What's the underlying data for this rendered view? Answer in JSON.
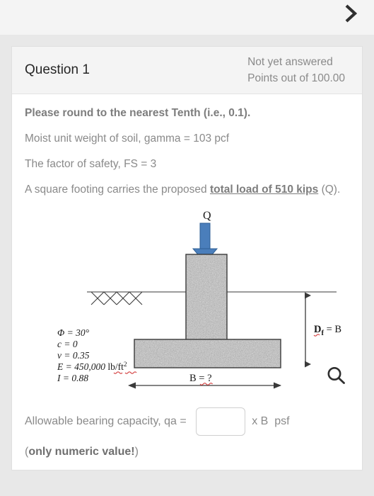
{
  "topbar": {
    "next_icon": "chevron-right-icon",
    "next_label": ""
  },
  "question": {
    "number_label": "Question 1",
    "status_line_1": "Not yet answered",
    "status_line_2": "Points out of 100.00",
    "body": {
      "line_1": "Please round to the nearest Tenth (i.e., 0.1).",
      "line_2": "Moist unit weight of soil, gamma = 103 pcf",
      "line_3": "The factor of safety, FS = 3",
      "line_4_prefix": "A square footing carries the proposed ",
      "line_4_emphasis": "total load of 510 kips",
      "line_4_suffix": " (Q)."
    }
  },
  "figure": {
    "load_label": "Q",
    "depth_label_main": "D",
    "depth_label_sub": "f",
    "depth_label_rest": " = B",
    "width_label": "B = ?",
    "soil_params": [
      "Φ = 30°",
      "c = 0",
      "ν = 0.35",
      "E = 450,000 lb/ft²",
      "I = 0.88"
    ],
    "param_E_value": "E = 450,000 ",
    "param_E_units": "lb/ft",
    "param_E_units_sup": "2",
    "magnifier_icon": "search-icon",
    "colors": {
      "arrow_blue": "#4a7ebb",
      "arrow_blue_dark": "#2e5f94",
      "concrete_gray": "#b8b8b8",
      "line_black": "#3a3a3a",
      "spellcheck_red": "#d23b3b"
    }
  },
  "answer": {
    "label": "Allowable bearing capacity, qa = ",
    "input_value": "",
    "input_placeholder": "",
    "unit": "x B  psf",
    "note_prefix": "(",
    "note_bold": "only numeric value!",
    "note_suffix": ")"
  }
}
